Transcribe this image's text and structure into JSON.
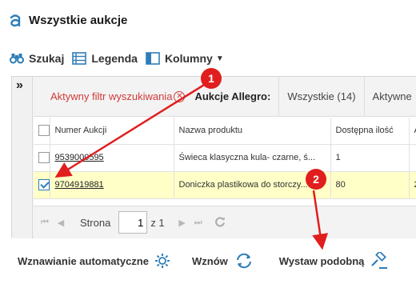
{
  "window": {
    "title": "Wszystkie aukcje",
    "logo_icon": "allegro-logo-icon"
  },
  "toolbar": {
    "search_label": "Szukaj",
    "legend_label": "Legenda",
    "columns_label": "Kolumny"
  },
  "filterbar": {
    "active_filter_label": "Aktywny filtr wyszukiwania",
    "allegro_label": "Aukcje Allegro:",
    "tabs": [
      "Wszystkie (14)",
      "Aktywne"
    ]
  },
  "grid": {
    "columns": [
      "Numer Aukcji",
      "Nazwa produktu",
      "Dostępna ilość",
      "A"
    ],
    "rows": [
      {
        "selected": false,
        "number": "9539000595",
        "name": "Świeca klasyczna kula- czarne, ś...",
        "qty": "1",
        "extra": ""
      },
      {
        "selected": true,
        "number": "9704919881",
        "name": "Doniczka plastikowa do storczy...",
        "qty": "80",
        "extra": "2"
      }
    ]
  },
  "pager": {
    "page_label": "Strona",
    "page_value": "1",
    "of_label": "z 1"
  },
  "actions": {
    "auto_renew_label": "Wznawianie automatyczne",
    "renew_label": "Wznów",
    "list_similar_label": "Wystaw podobną"
  },
  "annotations": {
    "badge1": "1",
    "badge2": "2",
    "arrow_color": "#e01e1e"
  },
  "colors": {
    "accent": "#2e7db8",
    "selected_row": "#ffffc7",
    "filter_red": "#d23a3a"
  }
}
